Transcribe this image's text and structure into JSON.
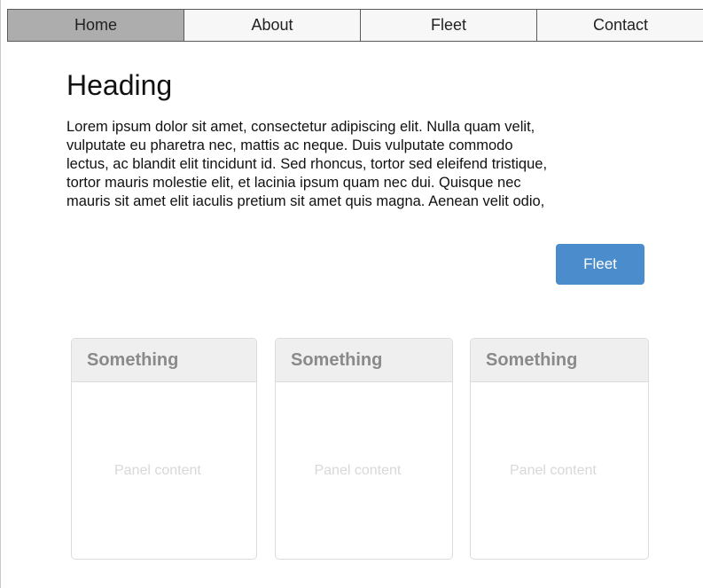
{
  "nav": {
    "items": [
      {
        "label": "Home"
      },
      {
        "label": "About"
      },
      {
        "label": "Fleet"
      },
      {
        "label": "Contact"
      }
    ]
  },
  "main": {
    "heading": "Heading",
    "paragraph_lines": [
      "Lorem ipsum dolor sit amet, consectetur adipiscing elit. Nulla quam velit,",
      "vulputate eu pharetra nec, mattis ac neque. Duis vulputate commodo",
      "lectus, ac blandit elit tincidunt id. Sed rhoncus, tortor sed eleifend tristique,",
      "tortor mauris molestie elit, et lacinia ipsum quam nec dui. Quisque nec",
      "mauris sit amet elit iaculis pretium sit amet quis magna. Aenean velit odio,"
    ],
    "fleet_button_label": "Fleet"
  },
  "panels": [
    {
      "title": "Something",
      "content": "Panel content"
    },
    {
      "title": "Something",
      "content": "Panel content"
    },
    {
      "title": "Something",
      "content": "Panel content"
    }
  ],
  "colors": {
    "active_nav": "#adadad",
    "button": "#4a8ccc",
    "panel_header": "#efefef"
  }
}
